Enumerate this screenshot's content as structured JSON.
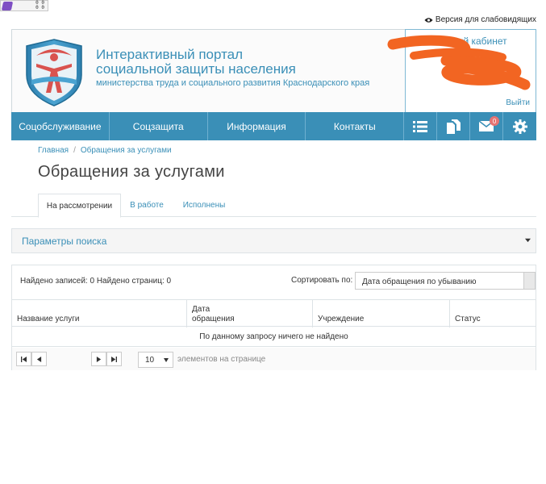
{
  "top": {
    "corner_widget": {
      "line1": "0 0",
      "line2": "0 0"
    },
    "accessibility_link": "Версия для слабовидящих"
  },
  "header": {
    "title_line1": "Интерактивный портал",
    "title_line2": "социальной защиты населения",
    "subtitle": "министерства труда и социального развития Краснодарского края",
    "account": {
      "title": "Личный кабинет",
      "logout": "Выйти"
    }
  },
  "nav": {
    "items": [
      "Соцобслуживание",
      "Соцзащита",
      "Информация",
      "Контакты"
    ],
    "icons": [
      "list-icon",
      "documents-icon",
      "mail-icon",
      "gear-icon"
    ],
    "mail_badge": "0"
  },
  "breadcrumb": {
    "home": "Главная",
    "separator": "/",
    "current": "Обращения за услугами"
  },
  "page_title": "Обращения за услугами",
  "tabs": [
    "На рассмотрении",
    "В работе",
    "Исполнены"
  ],
  "search": {
    "title": "Параметры поиска"
  },
  "results": {
    "found_text": "Найдено записей: 0 Найдено страниц: 0",
    "sort_label": "Сортировать по:",
    "sort_value": "Дата обращения по убыванию",
    "columns": [
      "Название услуги",
      "Дата обращения",
      "Учреждение",
      "Статус"
    ],
    "column2_line1": "Дата",
    "column2_line2": "обращения",
    "no_data": "По данному запросу ничего не найдено",
    "per_page_value": "10",
    "per_page_label": "элементов на странице"
  },
  "colors": {
    "primary": "#3a8fb7",
    "badge": "#e57373",
    "scribble": "#f26522"
  }
}
